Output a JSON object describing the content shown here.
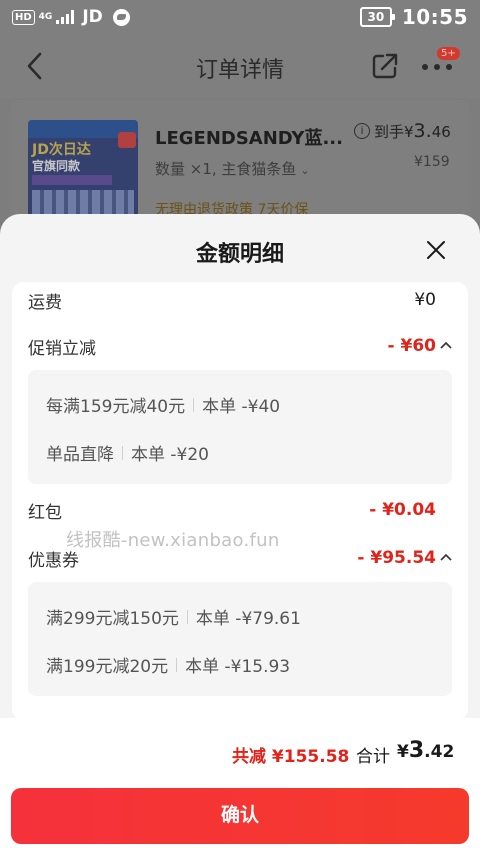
{
  "status_bar": {
    "hd": "HD",
    "network": "4G",
    "carrier": "JD",
    "battery": "30",
    "time": "10:55"
  },
  "header": {
    "title": "订单详情",
    "more_badge": "5+"
  },
  "product": {
    "thumb_text_1": "JD次日达",
    "thumb_text_2": "官旗同款",
    "name": "LEGENDSANDY蓝...",
    "spec": "数量 ×1, 主食猫条鱼",
    "policy": "无理由退货政策  7天价保",
    "info_icon": "i",
    "daoshou_label": "到手¥",
    "daoshou_int": "3.",
    "daoshou_dec": "46",
    "original_price": "¥159"
  },
  "sheet": {
    "title": "金额明细",
    "rows": {
      "shipping": {
        "label": "运费",
        "value": "¥0"
      },
      "promotion": {
        "label": "促销立减",
        "value": "- ¥60"
      },
      "red_packet": {
        "label": "红包",
        "value": "- ¥0.04"
      },
      "coupon": {
        "label": "优惠券",
        "value": "- ¥95.54"
      }
    },
    "promotion_details": [
      {
        "rule": "每满159元减40元",
        "amount": "本单 -¥40"
      },
      {
        "rule": "单品直降",
        "amount": "本单 -¥20"
      }
    ],
    "coupon_details": [
      {
        "rule": "满299元减150元",
        "amount": "本单 -¥79.61"
      },
      {
        "rule": "满199元减20元",
        "amount": "本单 -¥15.93"
      }
    ],
    "watermark": "线报酷-new.xianbao.fun"
  },
  "summary": {
    "discount": "共减 ¥155.58",
    "total_label": "合计",
    "total_currency": "¥",
    "total_int": "3",
    "total_dec": ".42"
  },
  "confirm_label": "确认",
  "colors": {
    "accent_red": "#e2231a",
    "overlay": "#7f7f7f",
    "sheet_bg": "#f4f4f4"
  }
}
